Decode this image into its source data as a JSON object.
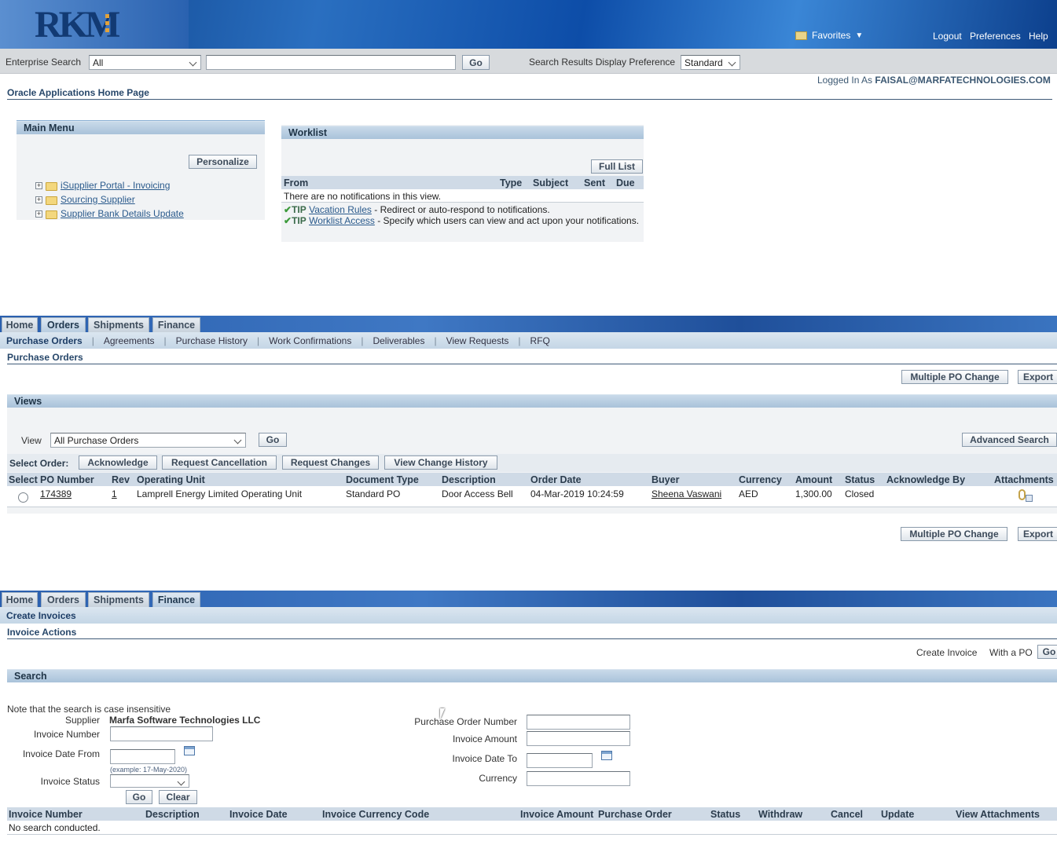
{
  "brand": {
    "logo_text": "RKM"
  },
  "global_nav": {
    "favorites": "Favorites",
    "logout": "Logout",
    "preferences": "Preferences",
    "help": "Help"
  },
  "search_bar": {
    "label": "Enterprise Search",
    "scope": "All",
    "query": "",
    "go": "Go",
    "pref_label": "Search Results Display Preference",
    "pref_value": "Standard"
  },
  "login": {
    "prefix": "Logged In As",
    "user": "FAISAL@MARFATECHNOLOGIES.COM"
  },
  "home": {
    "title": "Oracle Applications Home Page",
    "main_menu": {
      "title": "Main Menu",
      "personalize": "Personalize",
      "items": [
        "iSupplier Portal - Invoicing",
        "Sourcing Supplier",
        "Supplier Bank Details Update"
      ]
    },
    "worklist": {
      "title": "Worklist",
      "full_list": "Full List",
      "columns": [
        "From",
        "Type",
        "Subject",
        "Sent",
        "Due"
      ],
      "empty": "There are no notifications in this view.",
      "tips": [
        {
          "tag": "TIP",
          "link": "Vacation Rules",
          "text": "- Redirect or auto-respond to notifications."
        },
        {
          "tag": "TIP",
          "link": "Worklist Access",
          "text": "- Specify which users can view and act upon your notifications."
        }
      ]
    }
  },
  "tabs": [
    "Home",
    "Orders",
    "Shipments",
    "Finance"
  ],
  "orders": {
    "subnav": [
      "Purchase Orders",
      "Agreements",
      "Purchase History",
      "Work Confirmations",
      "Deliverables",
      "View Requests",
      "RFQ"
    ],
    "page_title": "Purchase Orders",
    "multi_po": "Multiple PO Change",
    "export": "Export",
    "views": {
      "title": "Views",
      "view_label": "View",
      "view_value": "All Purchase Orders",
      "go": "Go",
      "advanced": "Advanced Search"
    },
    "select_order": "Select Order:",
    "actions": [
      "Acknowledge",
      "Request Cancellation",
      "Request Changes",
      "View Change History"
    ],
    "columns": [
      "Select",
      "PO Number",
      "Rev",
      "Operating Unit",
      "Document Type",
      "Description",
      "Order Date",
      "Buyer",
      "Currency",
      "Amount",
      "Status",
      "Acknowledge By",
      "Attachments"
    ],
    "row": {
      "po": "174389",
      "rev": "1",
      "unit": "Lamprell Energy Limited Operating Unit",
      "doc_type": "Standard PO",
      "desc": "Door Access Bell",
      "date": "04-Mar-2019 10:24:59",
      "buyer": "Sheena Vaswani",
      "currency": "AED",
      "amount": "1,300.00",
      "status": "Closed",
      "ack_by": ""
    }
  },
  "finance": {
    "subnav": "Create Invoices",
    "page_title": "Invoice Actions",
    "create_label": "Create Invoice",
    "with_po": "With a PO",
    "go": "Go",
    "search": {
      "title": "Search",
      "note": "Note that the search is case insensitive",
      "supplier_label": "Supplier",
      "supplier_value": "Marfa Software Technologies LLC",
      "invoice_number": "Invoice Number",
      "date_from": "Invoice Date From",
      "example": "(example: 17-May-2020)",
      "status": "Invoice Status",
      "go": "Go",
      "clear": "Clear",
      "po_number": "Purchase Order Number",
      "amount": "Invoice Amount",
      "date_to": "Invoice Date To",
      "currency": "Currency"
    },
    "columns": [
      "Invoice Number",
      "Description",
      "Invoice Date",
      "Invoice Currency Code",
      "Invoice Amount",
      "Purchase Order",
      "Status",
      "Withdraw",
      "Cancel",
      "Update",
      "View Attachments"
    ],
    "empty": "No search conducted."
  }
}
